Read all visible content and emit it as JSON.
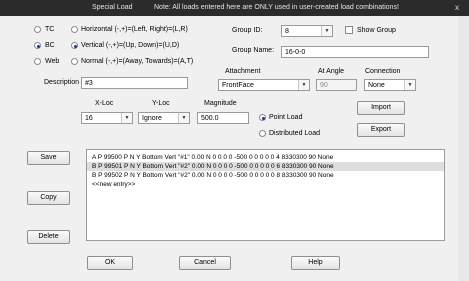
{
  "window": {
    "title": "Special Load",
    "note": "Note: All loads entered here are ONLY used in user-created load combinations!",
    "close": "x"
  },
  "type_options": [
    {
      "label": "TC",
      "selected": false
    },
    {
      "label": "BC",
      "selected": true
    },
    {
      "label": "Web",
      "selected": false
    }
  ],
  "direction_options": [
    {
      "label": "Horizontal (-,+)=(Left, Right)=(L,R)",
      "selected": false
    },
    {
      "label": "Vertical (-,+)=(Up, Down)=(U,D)",
      "selected": true
    },
    {
      "label": "Normal (-,+)=(Away, Towards)=(A,T)",
      "selected": false
    }
  ],
  "group_id": {
    "label": "Group ID:",
    "value": "8"
  },
  "show_group": {
    "label": "Show Group",
    "checked": false
  },
  "group_name": {
    "label": "Group Name:",
    "value": "16-0-0"
  },
  "description": {
    "label": "Description",
    "value": "#3"
  },
  "attachment": {
    "label": "Attachment",
    "value": "FrontFace"
  },
  "at_angle": {
    "label": "At Angle",
    "value": "90"
  },
  "connection": {
    "label": "Connection",
    "value": "None"
  },
  "xloc": {
    "label": "X-Loc",
    "value": "16"
  },
  "yloc": {
    "label": "Y-Loc",
    "value": "Ignore"
  },
  "magnitude": {
    "label": "Magnitude",
    "value": "500.0"
  },
  "load_type": [
    {
      "label": "Point Load",
      "selected": true
    },
    {
      "label": "Distributed Load",
      "selected": false
    }
  ],
  "buttons": {
    "import": "Import",
    "export": "Export",
    "save": "Save",
    "copy": "Copy",
    "delete": "Delete",
    "ok": "OK",
    "cancel": "Cancel",
    "help": "Help"
  },
  "entries": [
    "A P 99500 P N Y Bottom Vert \"#1\" 0.00 N 0 0 0 0 -500 0 0 0 0 0 4 8330300 90 None",
    "B P 99501 P N Y Bottom Vert \"#2\" 0.00 N 0 0 0 0 -500 0 0 0 0 0 6 8330300 90 None",
    "B P 99502 P N Y Bottom Vert \"#2\" 0.00 N 0 0 0 0 -500 0 0 0 0 0 8 8330300 90 None",
    "<<new entry>>"
  ]
}
